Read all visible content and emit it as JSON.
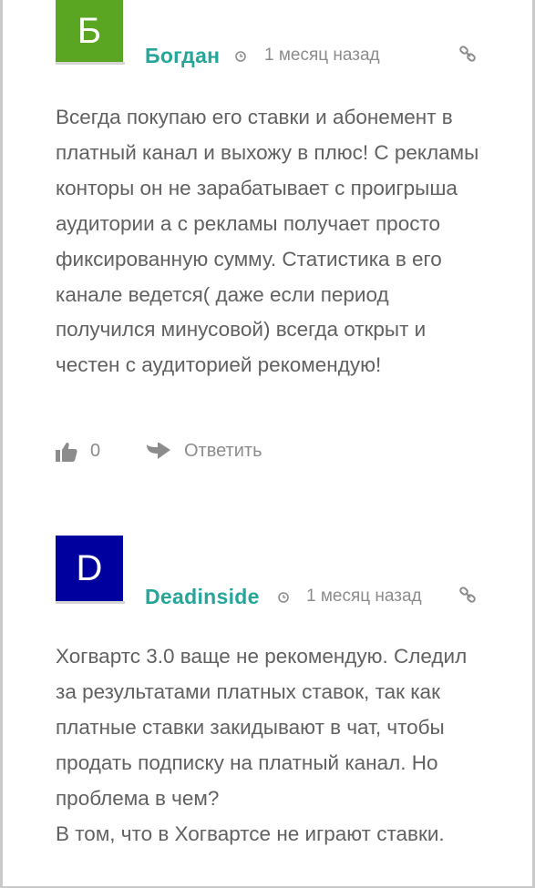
{
  "comments": [
    {
      "avatar_letter": "Б",
      "avatar_color": "#5aa521",
      "author": "Богдан",
      "time": "1 месяц назад",
      "paragraphs": [
        "Всегда покупаю его ставки и абонемент в платный канал и выхожу в плюс! С рекламы конторы он не зарабатывает с проигрыша аудитории а с рекламы получает просто фиксированную сумму. Статистика в его канале ведется( даже если период получился минусовой) всегда открыт и честен с аудиторией рекомендую!"
      ],
      "likes": "0",
      "reply_label": "Ответить"
    },
    {
      "avatar_letter": "D",
      "avatar_color": "#00009e",
      "author": "Deadinside",
      "time": "1 месяц назад",
      "paragraphs": [
        "Хогвартс 3.0 ваще не рекомендую. Следил за результатами платных ставок, так как платные ставки закидывают в чат, чтобы продать подписку на платный канал. Но проблема в чем?",
        "В том, что в Хогвартсе не играют ставки."
      ]
    }
  ],
  "icons": {
    "time": "clock-icon",
    "permalink": "link-icon",
    "like": "thumbs-up-icon",
    "reply": "reply-arrow-icon"
  },
  "colors": {
    "author": "#26a69a",
    "meta": "#8c8c8c",
    "text": "#616161"
  }
}
